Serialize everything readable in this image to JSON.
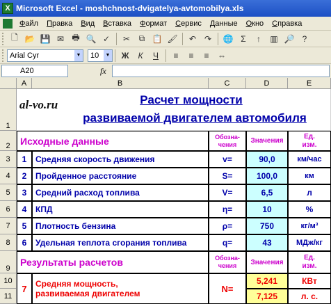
{
  "window": {
    "title": "Microsoft Excel - moshchnost-dvigatelya-avtomobilya.xls"
  },
  "menu": [
    "Файл",
    "Правка",
    "Вид",
    "Вставка",
    "Формат",
    "Сервис",
    "Данные",
    "Окно",
    "Справка"
  ],
  "toolbar": {
    "font_name": "Arial Cyr",
    "font_size": "10",
    "sum_symbol": "Σ"
  },
  "formula_bar": {
    "name_box": "A20",
    "fx_label": "fx",
    "formula": ""
  },
  "columns": [
    "A",
    "B",
    "C",
    "D",
    "E"
  ],
  "rows": [
    "1",
    "2",
    "3",
    "4",
    "5",
    "6",
    "7",
    "8",
    "9",
    "10",
    "11"
  ],
  "sheet": {
    "logo": "al-vo.ru",
    "title_line1": "Расчет мощности",
    "title_line2": "развиваемой двигателем автомобиля",
    "input_header": "Исходные данные",
    "col_designation": "Обозна-\nчения",
    "col_values": "Значения",
    "col_units": "Ед.\nизм.",
    "inputs": [
      {
        "n": "1",
        "name": "Средняя скорость движения",
        "sym": "v=",
        "val": "90,0",
        "unit": "км/час"
      },
      {
        "n": "2",
        "name": "Пройденное расстояние",
        "sym": "S=",
        "val": "100,0",
        "unit": "км"
      },
      {
        "n": "3",
        "name": "Средний расход топлива",
        "sym": "V=",
        "val": "6,5",
        "unit": "л"
      },
      {
        "n": "4",
        "name": "КПД",
        "sym": "η=",
        "val": "10",
        "unit": "%"
      },
      {
        "n": "5",
        "name": "Плотность бензина",
        "sym": "ρ=",
        "val": "750",
        "unit": "кг/м³"
      },
      {
        "n": "6",
        "name": "Удельная теплота сгорания топлива",
        "sym": "q=",
        "val": "43",
        "unit": "МДж/кг"
      }
    ],
    "results_header": "Результаты расчетов",
    "result": {
      "n": "7",
      "name_line1": "Средняя мощность,",
      "name_line2": "развиваемая двигателем",
      "sym": "N=",
      "val1": "5,241",
      "unit1": "КВт",
      "val2": "7,125",
      "unit2": "л. с."
    }
  },
  "colors": {
    "title_blue": "#0000aa",
    "header_magenta": "#cc00cc",
    "result_red": "#ee0000",
    "value_cyan": "#ccffff",
    "result_yellow": "#ffff99"
  }
}
